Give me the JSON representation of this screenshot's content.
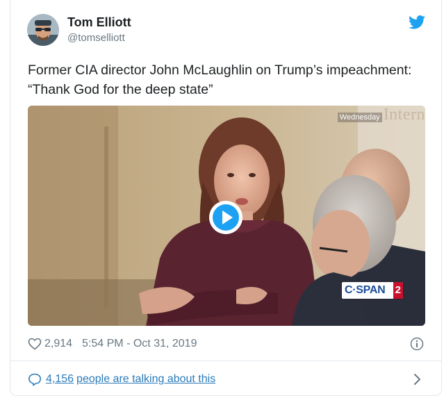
{
  "author": {
    "name": "Tom Elliott",
    "handle": "@tomselliott"
  },
  "tweet": {
    "text_line1": "Former CIA director John McLaughlin on Trump’s impeachment:",
    "text_line2": "“Thank God for the deep state”"
  },
  "media": {
    "banner_day": "Wednesday",
    "banner_word": "Intern",
    "network_logo_text": "C·SPAN",
    "network_logo_number": "2",
    "play_icon": "play-icon"
  },
  "meta": {
    "like_count": "2,914",
    "timestamp": "5:54 PM - Oct 31, 2019",
    "heart_icon": "heart-icon",
    "info_icon": "info-icon"
  },
  "footer": {
    "talking_count": "4,156",
    "talking_text": "people are talking about this",
    "bubble_icon": "speech-bubble-icon",
    "chevron_icon": "chevron-right-icon"
  },
  "colors": {
    "twitter_blue": "#1da1f2",
    "link_blue": "#2b7bb9",
    "secondary_text": "#697882",
    "primary_text": "#1c2022",
    "border": "#e1e8ed"
  }
}
